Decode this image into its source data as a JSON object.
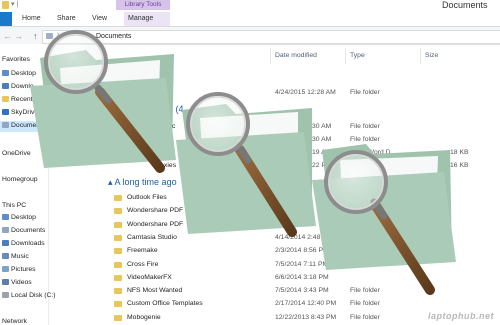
{
  "window": {
    "title": "Documents",
    "context_tab": "Library Tools"
  },
  "ribbon": {
    "file": "",
    "tabs": [
      "Home",
      "Share",
      "View",
      "Manage"
    ]
  },
  "address": {
    "path": "Documents"
  },
  "columns": {
    "date": "Date modified",
    "type": "Type",
    "size": "Size"
  },
  "nav": {
    "favorites": "Favorites",
    "fav_items": [
      "Desktop",
      "Downlo",
      "Recent pl",
      "SkyDrive",
      "Document"
    ],
    "onedrive": "OneDrive",
    "homegroup": "Homegroup",
    "thispc": "This PC",
    "pc_items": [
      "Desktop",
      "Documents",
      "Downloads",
      "Music",
      "Pictures",
      "Videos",
      "Local Disk (C:)"
    ],
    "network": "Network"
  },
  "groups": {
    "earlier_frag": "ear (4",
    "long_ago": "A long time ago"
  },
  "top_row": {
    "date": "4/24/2015 12:28 AM",
    "type": "File folder"
  },
  "partial_rows": [
    {
      "name": "roc",
      "date": "30 AM",
      "type": "File folder",
      "size": ""
    },
    {
      "name": "",
      "date": "30 AM",
      "type": "File folder",
      "size": ""
    },
    {
      "name": "",
      "date": "19 AM",
      "type": "ft Word D...",
      "size": "18 KB"
    },
    {
      "name": "xies",
      "date": "22 PM",
      "type": "ft Word D...",
      "size": "16 KB"
    }
  ],
  "rows": [
    {
      "name": "Outlook Files",
      "date": "",
      "type": "",
      "size": ""
    },
    {
      "name": "Wondershare PDF",
      "date": "",
      "type": "",
      "size": ""
    },
    {
      "name": "Wondershare PDF",
      "date": "",
      "type": "",
      "size": ""
    },
    {
      "name": "Camtasia Studio",
      "date": "4/14/2014 2:48 PM",
      "type": "",
      "size": ""
    },
    {
      "name": "Freemake",
      "date": "2/3/2014 8:56 P",
      "type": "",
      "size": ""
    },
    {
      "name": "Cross Fire",
      "date": "7/5/2014 7:11 PM",
      "type": "",
      "size": ""
    },
    {
      "name": "VideoMakerFX",
      "date": "6/6/2014 3:18 PM",
      "type": "",
      "size": ""
    },
    {
      "name": "NFS Most Wanted",
      "date": "7/5/2014 3:43 PM",
      "type": "File folder",
      "size": ""
    },
    {
      "name": "Custom Office Templates",
      "date": "2/17/2014 12:40 PM",
      "type": "File folder",
      "size": ""
    },
    {
      "name": "Mobogenie",
      "date": "12/22/2013 8:43 PM",
      "type": "File folder",
      "size": ""
    }
  ],
  "watermark": "laptophub.net",
  "icons": [
    "back-arrow-icon",
    "forward-arrow-icon",
    "up-arrow-icon",
    "folder-icon",
    "magnifier-icon"
  ],
  "colors": {
    "file_tab": "#1979ca",
    "library_tools": "#d7c3e9",
    "selection": "#cce8ff",
    "folder_illus": "#a9cbb7",
    "link": "#1e5fa8"
  }
}
